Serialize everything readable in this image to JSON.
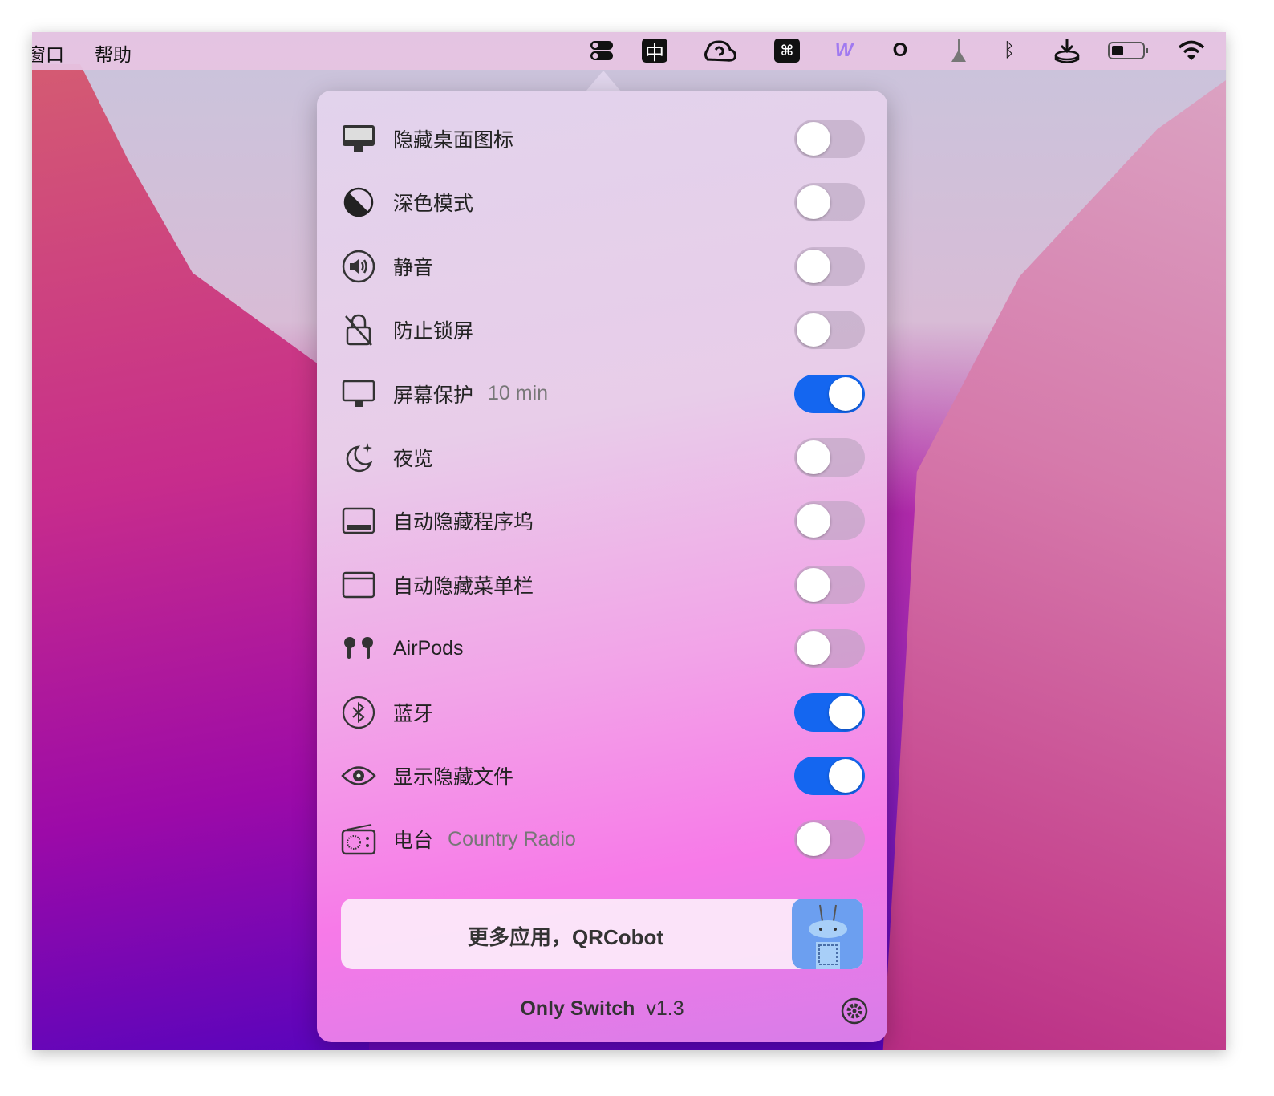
{
  "menubar": {
    "menus": [
      "窗口",
      "帮助"
    ],
    "status_icons": [
      "only-switch-icon",
      "input-method-icon",
      "cloud-icon",
      "command-icon",
      "w-app-icon",
      "o-app-icon",
      "broom-icon",
      "bluetooth-icon",
      "download-icon",
      "battery-icon",
      "wifi-icon"
    ],
    "input_method_label": "中",
    "o_label": "O"
  },
  "panel": {
    "rows": [
      {
        "label": "隐藏桌面图标",
        "icon": "desktop-icon",
        "on": false
      },
      {
        "label": "深色模式",
        "icon": "dark-mode-icon",
        "on": false
      },
      {
        "label": "静音",
        "icon": "speaker-icon",
        "on": false
      },
      {
        "label": "防止锁屏",
        "icon": "lock-slash-icon",
        "on": false
      },
      {
        "label": "屏幕保护",
        "sub": "10 min",
        "icon": "monitor-icon",
        "on": true
      },
      {
        "label": "夜览",
        "icon": "moon-icon",
        "on": false
      },
      {
        "label": "自动隐藏程序坞",
        "icon": "dock-icon",
        "on": false
      },
      {
        "label": "自动隐藏菜单栏",
        "icon": "menubar-icon",
        "on": false
      },
      {
        "label": "AirPods",
        "icon": "airpods-icon",
        "on": false
      },
      {
        "label": "蓝牙",
        "icon": "bluetooth-icon",
        "on": true
      },
      {
        "label": "显示隐藏文件",
        "icon": "eye-icon",
        "on": true
      },
      {
        "label": "电台",
        "sub": "Country Radio",
        "icon": "radio-icon",
        "on": false
      }
    ],
    "promo": "更多应用，QRCobot",
    "app_name": "Only Switch",
    "version": "v1.3"
  },
  "colors": {
    "toggle_on": "#1466f0"
  }
}
